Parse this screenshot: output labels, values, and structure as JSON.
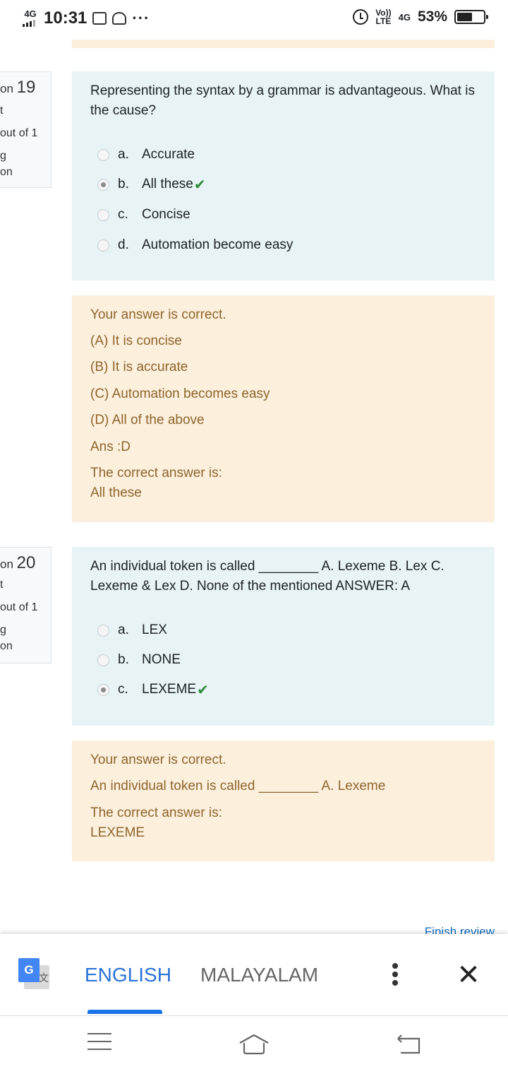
{
  "status_bar": {
    "network_left": "4G",
    "time": "10:31",
    "notification_icons": [
      "message-icon",
      "stack-icon"
    ],
    "overflow": "···",
    "volte_line1": "Vo))",
    "volte_line2": "LTE",
    "network_right": "4G",
    "battery_percent": "53%",
    "battery_level": 0.53
  },
  "questions": [
    {
      "info": {
        "prefix": "on",
        "number": "19",
        "line2": "t",
        "line3": "out of 1",
        "line4": "g",
        "line5": "on"
      },
      "text": "Representing the syntax by a grammar is advantageous. What is the cause?",
      "options": [
        {
          "letter": "a.",
          "label": "Accurate",
          "selected": false
        },
        {
          "letter": "b.",
          "label": "All these",
          "selected": true
        },
        {
          "letter": "c.",
          "label": "Concise",
          "selected": false
        },
        {
          "letter": "d.",
          "label": "Automation become easy",
          "selected": false
        }
      ],
      "feedback": [
        "Your answer is correct.",
        "(A) It is concise",
        "(B) It is accurate",
        "(C) Automation becomes easy",
        "(D) All of the above",
        "Ans :D",
        "The correct answer is:",
        "All these"
      ]
    },
    {
      "info": {
        "prefix": "on",
        "number": "20",
        "line2": "t",
        "line3": "out of 1",
        "line4": "g",
        "line5": "on"
      },
      "text": "An individual token is called ________ A. Lexeme B. Lex C. Lexeme & Lex D. None of the mentioned ANSWER: A",
      "options": [
        {
          "letter": "a.",
          "label": "LEX",
          "selected": false
        },
        {
          "letter": "b.",
          "label": "NONE",
          "selected": false
        },
        {
          "letter": "c.",
          "label": "LEXEME",
          "selected": true
        }
      ],
      "feedback": [
        "Your answer is correct.",
        "An individual token is called ________ A. Lexeme",
        "The correct answer is:",
        "LEXEME"
      ]
    }
  ],
  "check_mark": "✔",
  "finish_review": "Finish review",
  "translate_bar": {
    "icon": "google-translate-icon",
    "icon_g": "G",
    "icon_zh": "文",
    "tab_english": "ENGLISH",
    "tab_malayalam": "MALAYALAM",
    "more": "more-vert-icon",
    "close": "✕"
  },
  "nav_bar": {
    "icons": [
      "menu-icon",
      "home-icon",
      "back-icon"
    ]
  }
}
